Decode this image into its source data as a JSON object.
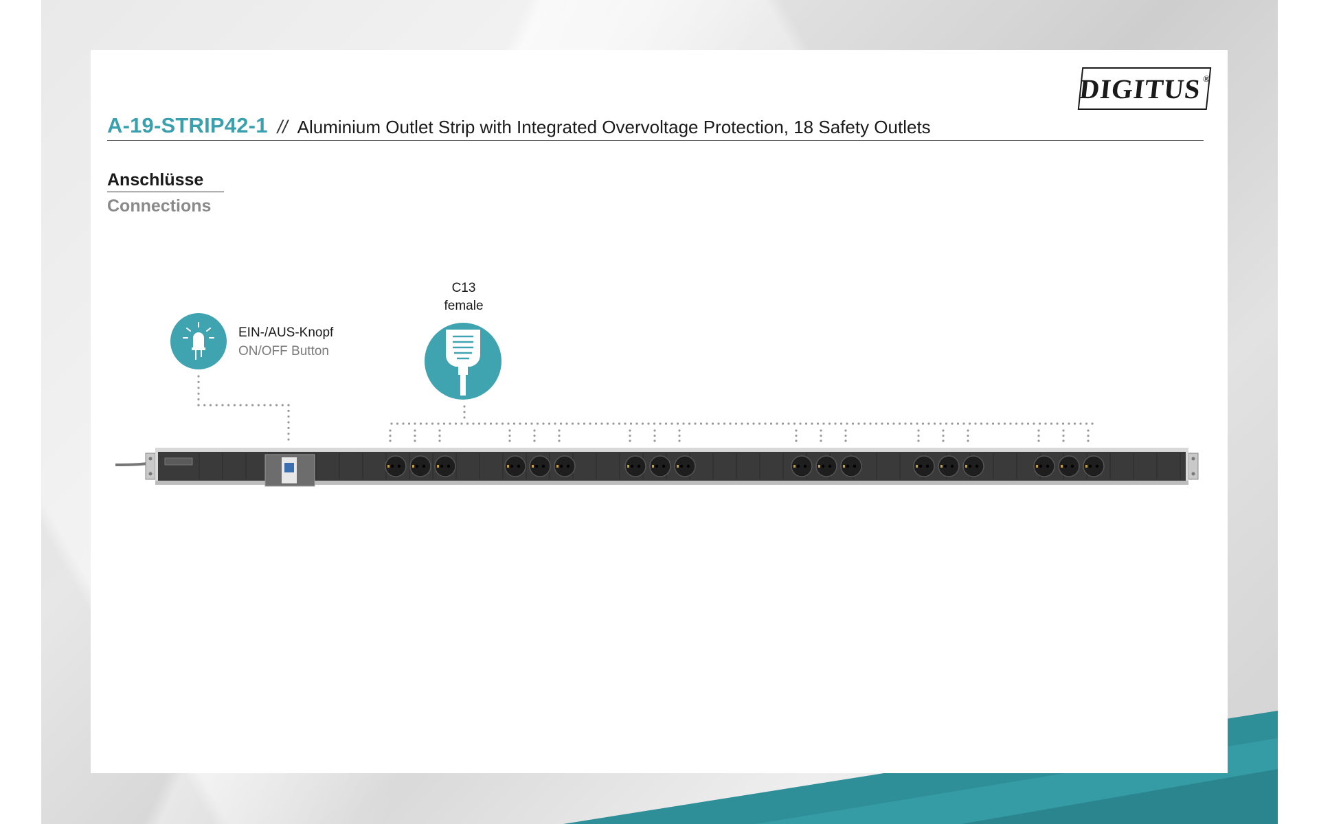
{
  "brand": {
    "logo_text": "DIGITUS",
    "registered": "®"
  },
  "header": {
    "model": "A-19-STRIP42-1",
    "separator": "//",
    "description": "Aluminium Outlet Strip with Integrated Overvoltage Protection, 18 Safety Outlets"
  },
  "section": {
    "title_de": "Anschlüsse",
    "title_en": "Connections"
  },
  "callouts": {
    "button": {
      "label_de": "EIN-/AUS-Knopf",
      "label_en": "ON/OFF Button",
      "icon": "bulb-icon"
    },
    "c13": {
      "label_line1": "C13",
      "label_line2": "female",
      "icon": "c13-plug-icon"
    }
  },
  "colors": {
    "accent": "#3aa0ad",
    "teal_band": "#2f8f98",
    "strip_body": "#3a3a3a"
  },
  "product": {
    "outlet_groups": 6,
    "outlets_per_group": 3
  }
}
